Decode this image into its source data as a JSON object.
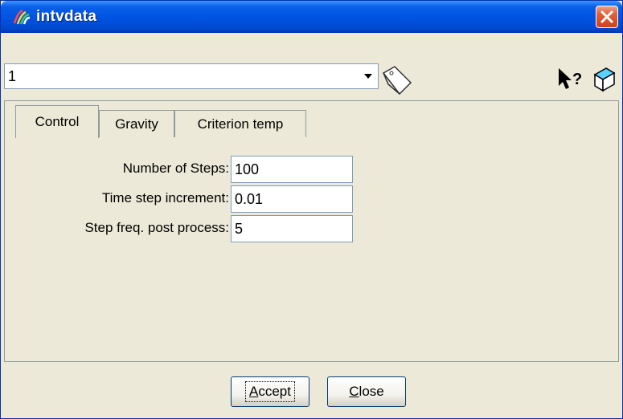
{
  "window": {
    "title": "intvdata"
  },
  "toolbar": {
    "selector_value": "1"
  },
  "tabs": [
    {
      "label": "Control",
      "active": true
    },
    {
      "label": "Gravity",
      "active": false
    },
    {
      "label": "Criterion temp",
      "active": false
    }
  ],
  "fields": [
    {
      "label": "Number of Steps:",
      "value": "100"
    },
    {
      "label": "Time step increment:",
      "value": "0.01"
    },
    {
      "label": "Step freq. post process:",
      "value": "5"
    }
  ],
  "buttons": {
    "accept": "Accept",
    "accept_mnemonic": "A",
    "close": "Close",
    "close_mnemonic": "C"
  },
  "icons": {
    "app": "app-icon",
    "close": "close-icon",
    "dropdown": "chevron-down-icon",
    "tag": "tag-icon",
    "help": "help-pointer-icon",
    "erase": "eraser-icon"
  },
  "colors": {
    "titlebar": "#0054e3",
    "background": "#ece9d8",
    "close_button": "#d0401e"
  }
}
